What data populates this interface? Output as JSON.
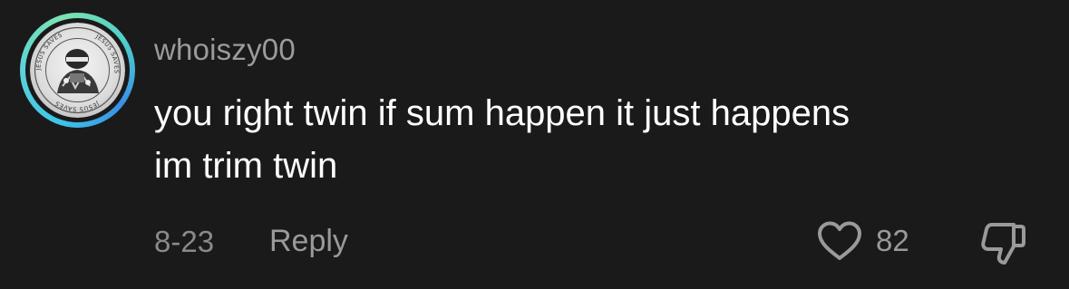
{
  "comment": {
    "username": "whoiszy00",
    "text_line1": "you right twin if sum happen it just happens",
    "text_line2": "im trim twin",
    "date": "8-23",
    "reply_label": "Reply",
    "like_count": "82",
    "avatar_ring_text": "JESUS SAVES",
    "icons": {
      "like": "heart-icon",
      "dislike": "thumbs-down-icon"
    },
    "colors": {
      "background": "#1a1a1a",
      "text": "#ffffff",
      "muted": "#9a9a9a",
      "ring_start": "#3ec6e8",
      "ring_end": "#7be3b0"
    }
  }
}
